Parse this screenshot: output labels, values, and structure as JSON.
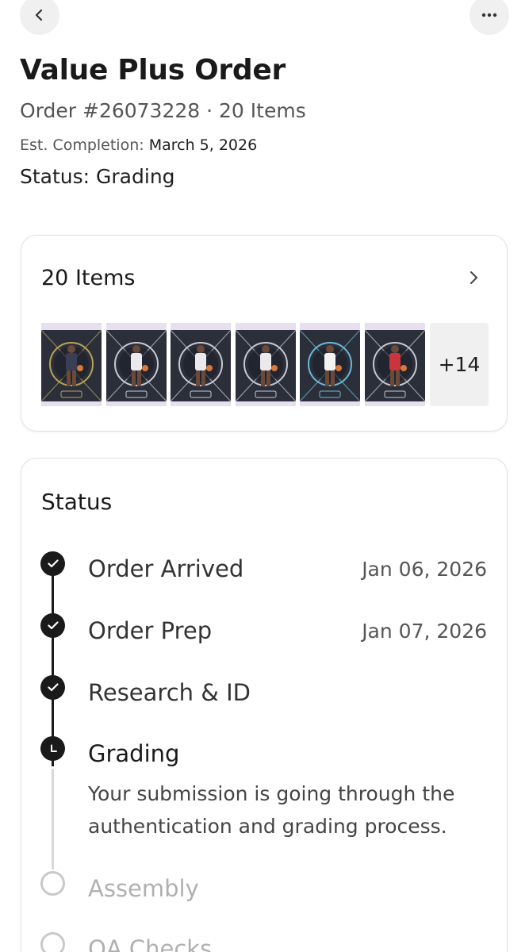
{
  "header": {
    "back_icon": "chevron-left-icon",
    "more_icon": "more-horizontal-icon",
    "title": "Value Plus Order",
    "subtitle": "Order #26073228 · 20 Items",
    "est_label": "Est. Completion:",
    "est_date": "March 5, 2026",
    "status_text": "Status: Grading"
  },
  "items_card": {
    "title": "20 Items",
    "chevron_icon": "chevron-right-icon",
    "thumbnails": [
      {
        "alt": "card-1",
        "frame_color": "#b9a35a",
        "jersey_color": "#3a3f55"
      },
      {
        "alt": "card-2",
        "frame_color": "#c8c8d0",
        "jersey_color": "#e9e9ee"
      },
      {
        "alt": "card-3",
        "frame_color": "#c8c8d0",
        "jersey_color": "#e9e9ee"
      },
      {
        "alt": "card-4",
        "frame_color": "#c8c8d0",
        "jersey_color": "#e9e9ee"
      },
      {
        "alt": "card-5",
        "frame_color": "#6fb8d6",
        "jersey_color": "#f3f3f3"
      },
      {
        "alt": "card-6",
        "frame_color": "#c8c8d0",
        "jersey_color": "#c8353a"
      }
    ],
    "more_count": "+14"
  },
  "status_card": {
    "title": "Status",
    "steps": [
      {
        "label": "Order Arrived",
        "date": "Jan 06, 2026",
        "state": "done"
      },
      {
        "label": "Order Prep",
        "date": "Jan 07, 2026",
        "state": "done"
      },
      {
        "label": "Research & ID",
        "date": "",
        "state": "done"
      },
      {
        "label": "Grading",
        "date": "",
        "state": "current",
        "description": "Your submission is going through the authentication and grading process."
      },
      {
        "label": "Assembly",
        "date": "",
        "state": "pending"
      },
      {
        "label": "QA Checks",
        "date": "",
        "state": "pending"
      }
    ]
  },
  "colors": {
    "accent": "#1a1a1a",
    "pending": "#b0b0b0",
    "surface": "#f0f0f0"
  }
}
